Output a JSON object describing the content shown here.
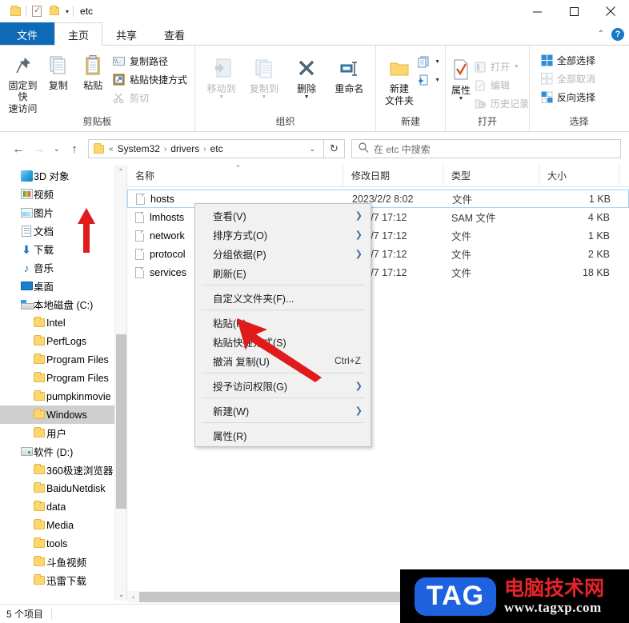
{
  "window": {
    "title": "etc",
    "quick_access": [
      "folder-icon",
      "properties-icon",
      "new-folder-icon",
      "customize-caret"
    ],
    "controls": {
      "minimize": "—",
      "maximize": "☐",
      "close": "✕"
    }
  },
  "ribbon": {
    "tabs": [
      {
        "label": "文件",
        "kind": "file"
      },
      {
        "label": "主页",
        "kind": "active"
      },
      {
        "label": "共享",
        "kind": "normal"
      },
      {
        "label": "查看",
        "kind": "normal"
      }
    ],
    "collapse_icon": "chevron-up-icon",
    "help_icon": "?",
    "groups": [
      {
        "name": "剪贴板",
        "big": [
          {
            "label": "固定到快\n速访问",
            "label1": "固定到快",
            "label2": "速访问",
            "icon": "pin-icon",
            "disabled": false
          },
          {
            "label": "复制",
            "icon": "copy-icon",
            "disabled": false
          },
          {
            "label": "粘贴",
            "icon": "paste-icon",
            "disabled": false
          }
        ],
        "small": [
          {
            "label": "复制路径",
            "icon": "copy-path-icon",
            "disabled": false
          },
          {
            "label": "粘贴快捷方式",
            "icon": "paste-shortcut-icon",
            "disabled": false
          },
          {
            "label": "剪切",
            "icon": "scissors-icon",
            "disabled": true
          }
        ]
      },
      {
        "name": "组织",
        "big": [
          {
            "label": "移动到",
            "icon": "move-to-icon",
            "disabled": true,
            "dropdown": true
          },
          {
            "label": "复制到",
            "icon": "copy-to-icon",
            "disabled": true,
            "dropdown": true
          },
          {
            "label": "删除",
            "icon": "delete-x-icon",
            "disabled": false,
            "dropdown": true
          },
          {
            "label": "重命名",
            "icon": "rename-icon",
            "disabled": false
          }
        ]
      },
      {
        "name": "新建",
        "big": [
          {
            "label1": "新建",
            "label2": "文件夹",
            "icon": "new-folder-icon",
            "disabled": false
          }
        ],
        "small": [
          {
            "label": "",
            "icon": "new-item-icon",
            "disabled": false,
            "dropdown": true
          },
          {
            "label": "",
            "icon": "easy-access-icon",
            "disabled": false,
            "dropdown": true
          }
        ]
      },
      {
        "name": "打开",
        "big": [
          {
            "label": "属性",
            "icon": "properties-icon",
            "disabled": false,
            "dropdown": true
          }
        ],
        "small": [
          {
            "label": "打开",
            "icon": "open-icon",
            "disabled": true,
            "dropdown": true
          },
          {
            "label": "编辑",
            "icon": "edit-icon",
            "disabled": true
          },
          {
            "label": "历史记录",
            "icon": "history-icon",
            "disabled": true
          }
        ]
      },
      {
        "name": "选择",
        "small": [
          {
            "label": "全部选择",
            "icon": "select-all-icon",
            "disabled": false
          },
          {
            "label": "全部取消",
            "icon": "select-none-icon",
            "disabled": true
          },
          {
            "label": "反向选择",
            "icon": "invert-selection-icon",
            "disabled": false
          }
        ]
      }
    ]
  },
  "address_bar": {
    "back_icon": "←",
    "forward_icon": "→",
    "recent_icon": "⌄",
    "up_icon": "↑",
    "overflow": "«",
    "crumbs": [
      "System32",
      "drivers",
      "etc"
    ],
    "dropdown_icon": "⌄",
    "refresh_icon": "↻",
    "search_icon": "search-icon",
    "search_placeholder": "在 etc 中搜索"
  },
  "nav_pane": {
    "items": [
      {
        "label": "3D 对象",
        "icon": "3d-objects-icon",
        "indent": 1,
        "selected": false
      },
      {
        "label": "视频",
        "icon": "videos-icon",
        "indent": 1,
        "selected": false
      },
      {
        "label": "图片",
        "icon": "pictures-icon",
        "indent": 1,
        "selected": false
      },
      {
        "label": "文档",
        "icon": "documents-icon",
        "indent": 1,
        "selected": false
      },
      {
        "label": "下载",
        "icon": "downloads-icon",
        "indent": 1,
        "selected": false
      },
      {
        "label": "音乐",
        "icon": "music-icon",
        "indent": 1,
        "selected": false
      },
      {
        "label": "桌面",
        "icon": "desktop-icon",
        "indent": 1,
        "selected": false
      },
      {
        "label": "本地磁盘 (C:)",
        "icon": "local-disk-icon",
        "indent": 1,
        "selected": false
      },
      {
        "label": "Intel",
        "icon": "folder-icon",
        "indent": 2,
        "selected": false
      },
      {
        "label": "PerfLogs",
        "icon": "folder-icon",
        "indent": 2,
        "selected": false
      },
      {
        "label": "Program Files",
        "icon": "folder-icon",
        "indent": 2,
        "selected": false
      },
      {
        "label": "Program Files",
        "icon": "folder-icon",
        "indent": 2,
        "selected": false
      },
      {
        "label": "pumpkinmovie",
        "icon": "folder-icon",
        "indent": 2,
        "selected": false
      },
      {
        "label": "Windows",
        "icon": "folder-icon",
        "indent": 2,
        "selected": true
      },
      {
        "label": "用户",
        "icon": "folder-icon",
        "indent": 2,
        "selected": false
      },
      {
        "label": "软件 (D:)",
        "icon": "drive-icon",
        "indent": 1,
        "selected": false
      },
      {
        "label": "360极速浏览器",
        "icon": "folder-icon",
        "indent": 2,
        "selected": false
      },
      {
        "label": "BaiduNetdisk",
        "icon": "folder-icon",
        "indent": 2,
        "selected": false
      },
      {
        "label": "data",
        "icon": "folder-icon",
        "indent": 2,
        "selected": false
      },
      {
        "label": "Media",
        "icon": "folder-icon",
        "indent": 2,
        "selected": false
      },
      {
        "label": "tools",
        "icon": "folder-icon",
        "indent": 2,
        "selected": false
      },
      {
        "label": "斗鱼视频",
        "icon": "folder-icon",
        "indent": 2,
        "selected": false
      },
      {
        "label": "迅雷下载",
        "icon": "folder-icon",
        "indent": 2,
        "selected": false
      }
    ],
    "scroll_up": "⌃",
    "scroll_down": "⌄"
  },
  "file_list": {
    "columns": [
      "名称",
      "修改日期",
      "类型",
      "大小"
    ],
    "rows": [
      {
        "name": "hosts",
        "date": "2023/2/2 8:02",
        "type": "文件",
        "size": "1 KB",
        "selected": true
      },
      {
        "name": "lmhosts",
        "date": "9/12/7 17:12",
        "type": "SAM 文件",
        "size": "4 KB",
        "selected": false
      },
      {
        "name": "network",
        "date": "9/12/7 17:12",
        "type": "文件",
        "size": "1 KB",
        "selected": false
      },
      {
        "name": "protocol",
        "date": "9/12/7 17:12",
        "type": "文件",
        "size": "2 KB",
        "selected": false
      },
      {
        "name": "services",
        "date": "9/12/7 17:12",
        "type": "文件",
        "size": "18 KB",
        "selected": false
      }
    ]
  },
  "context_menu": {
    "items": [
      {
        "label": "查看(V)",
        "submenu": true,
        "shortcut": ""
      },
      {
        "label": "排序方式(O)",
        "submenu": true,
        "shortcut": ""
      },
      {
        "label": "分组依据(P)",
        "submenu": true,
        "shortcut": ""
      },
      {
        "label": "刷新(E)",
        "submenu": false,
        "shortcut": ""
      },
      {
        "separator": true
      },
      {
        "label": "自定义文件夹(F)...",
        "submenu": false,
        "shortcut": ""
      },
      {
        "separator": true
      },
      {
        "label": "粘贴(P)",
        "submenu": false,
        "shortcut": ""
      },
      {
        "label": "粘贴快捷方式(S)",
        "submenu": false,
        "shortcut": ""
      },
      {
        "label": "撤消 复制(U)",
        "submenu": false,
        "shortcut": "Ctrl+Z"
      },
      {
        "separator": true
      },
      {
        "label": "授予访问权限(G)",
        "submenu": true,
        "shortcut": ""
      },
      {
        "separator": true
      },
      {
        "label": "新建(W)",
        "submenu": true,
        "shortcut": ""
      },
      {
        "separator": true
      },
      {
        "label": "属性(R)",
        "submenu": false,
        "shortcut": ""
      }
    ]
  },
  "status_bar": {
    "item_count": "5 个项目"
  },
  "watermark": {
    "logo": "TAG",
    "site_name": "电脑技术网",
    "url": "www.tagxp.com"
  },
  "colors": {
    "file_tab_blue": "#0e69b6",
    "selection_gray": "#cfcfcf",
    "selected_row_border": "#a8d4f2",
    "arrow_red": "#e01b1b",
    "folder_yellow": "#fcd770",
    "watermark_red": "#e8232a",
    "watermark_blue": "#1f62e0"
  }
}
